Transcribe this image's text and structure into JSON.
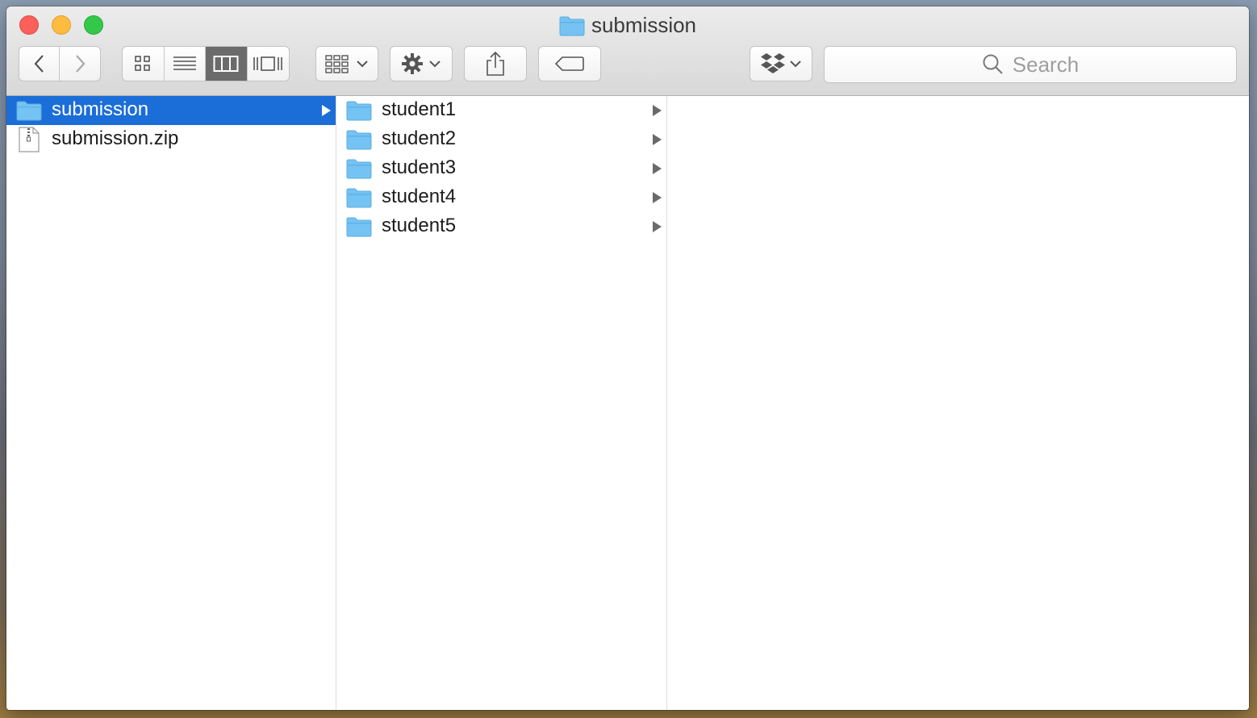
{
  "window": {
    "title": "submission"
  },
  "toolbar": {
    "back_icon": "chevron-left-icon",
    "forward_icon": "chevron-right-icon",
    "view_modes": [
      "icon-view",
      "list-view",
      "column-view",
      "cover-flow-view"
    ],
    "active_view": "column-view",
    "search_placeholder": "Search"
  },
  "columns": [
    {
      "items": [
        {
          "name": "submission",
          "type": "folder",
          "selected": true,
          "has_children": true
        },
        {
          "name": "submission.zip",
          "type": "zip-file",
          "selected": false,
          "has_children": false
        }
      ]
    },
    {
      "items": [
        {
          "name": "student1",
          "type": "folder",
          "has_children": true
        },
        {
          "name": "student2",
          "type": "folder",
          "has_children": true
        },
        {
          "name": "student3",
          "type": "folder",
          "has_children": true
        },
        {
          "name": "student4",
          "type": "folder",
          "has_children": true
        },
        {
          "name": "student5",
          "type": "folder",
          "has_children": true
        }
      ]
    },
    {
      "items": []
    }
  ],
  "colors": {
    "selection": "#1b6ed8",
    "folder": "#74c3f2",
    "close": "#fc605b",
    "minimize": "#fdbc40",
    "maximize": "#34c84a"
  }
}
